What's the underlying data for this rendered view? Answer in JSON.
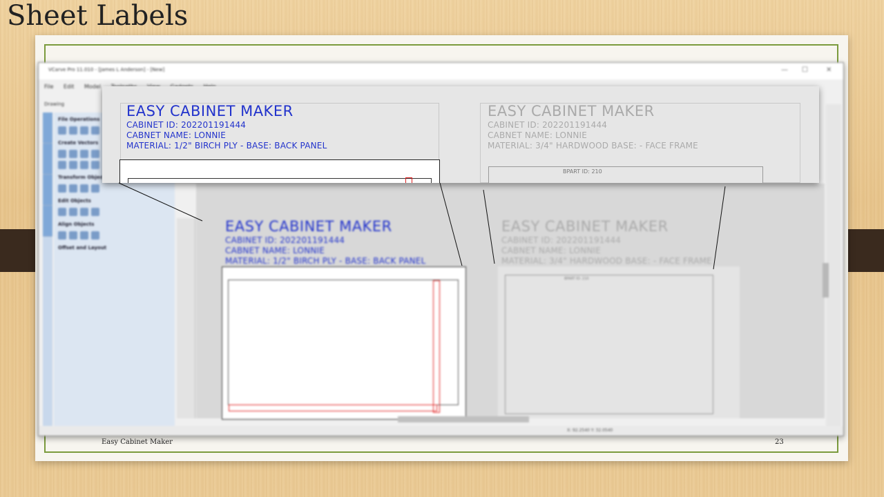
{
  "slide": {
    "title": "Sheet Labels",
    "footer_left": "Easy Cabinet Maker",
    "page_number": "23"
  },
  "app": {
    "window_title": "VCarve Pro 11.010 - [James L Anderson] - [New]",
    "menu": [
      "File",
      "Edit",
      "Model",
      "Toolpaths",
      "View",
      "Gadgets",
      "Help"
    ],
    "drawing_tab": "Drawing",
    "left_panel_sections": [
      "File Operations",
      "Create Vectors",
      "Transform Objects",
      "Edit Objects",
      "Align Objects",
      "Offset and Layout"
    ],
    "status_coords": "X: 92.2540  Y: 32.0540"
  },
  "labels": {
    "left": {
      "title": "EASY CABINET MAKER",
      "cabinet_id": "CABINET ID: 202201191444",
      "cabinet_name": "CABNET NAME: LONNIE",
      "material": "MATERIAL: 1/2\" BIRCH PLY - BASE: BACK PANEL"
    },
    "right": {
      "title": "EASY CABINET MAKER",
      "cabinet_id": "CABINET ID: 202201191444",
      "cabinet_name": "CABNET NAME: LONNIE",
      "material": "MATERIAL: 3/4\" HARDWOOD BASE: - FACE FRAME",
      "part_label": "BPART ID: 210"
    }
  },
  "colors": {
    "label_blue": "#2233cc",
    "label_grey": "#aaaaaa",
    "slide_border": "#7a9a3c"
  }
}
